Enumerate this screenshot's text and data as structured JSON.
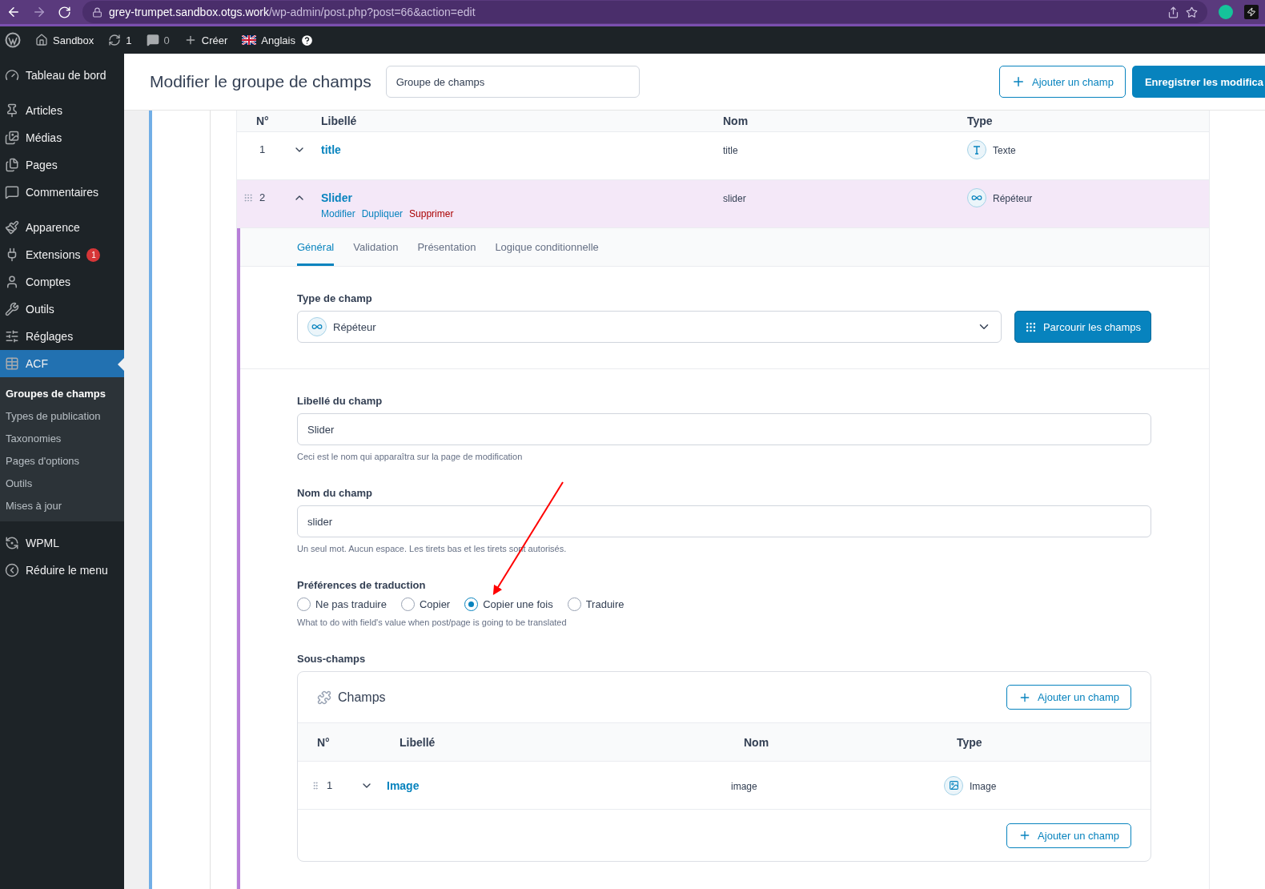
{
  "browser": {
    "url_host": "grey-trumpet.sandbox.otgs.work",
    "url_path": "/wp-admin/post.php?post=66&action=edit"
  },
  "admin_bar": {
    "site": "Sandbox",
    "updates": "1",
    "comments": "0",
    "new": "Créer",
    "language": "Anglais"
  },
  "sidebar": {
    "groups": [
      {
        "items": [
          {
            "label": "Tableau de bord",
            "selected": false
          }
        ]
      },
      {
        "items": [
          {
            "label": "Articles",
            "selected": false
          },
          {
            "label": "Médias",
            "selected": false
          },
          {
            "label": "Pages",
            "selected": false
          },
          {
            "label": "Commentaires",
            "selected": false
          }
        ]
      },
      {
        "items": [
          {
            "label": "Apparence",
            "selected": false
          },
          {
            "label": "Extensions",
            "selected": false,
            "badge": "1"
          },
          {
            "label": "Comptes",
            "selected": false
          },
          {
            "label": "Outils",
            "selected": false
          },
          {
            "label": "Réglages",
            "selected": false
          },
          {
            "label": "ACF",
            "selected": true,
            "children": [
              {
                "label": "Groupes de champs",
                "selected": true
              },
              {
                "label": "Types de publication",
                "selected": false
              },
              {
                "label": "Taxonomies",
                "selected": false
              },
              {
                "label": "Pages d'options",
                "selected": false
              },
              {
                "label": "Outils",
                "selected": false
              },
              {
                "label": "Mises à jour",
                "selected": false
              }
            ]
          }
        ]
      },
      {
        "items": [
          {
            "label": "WPML",
            "selected": false
          },
          {
            "label": "Réduire le menu",
            "selected": false
          }
        ]
      }
    ]
  },
  "header": {
    "title": "Modifier le groupe de champs",
    "group_name": "Groupe de champs",
    "add_button": "Ajouter un champ",
    "save_button": "Enregistrer les modifica"
  },
  "fields_table": {
    "columns": [
      "N°",
      "Libellé",
      "Nom",
      "Type"
    ],
    "rows": [
      {
        "number": "1",
        "label": "title",
        "name": "title",
        "type": "Texte",
        "kind": "text",
        "expanded": false
      },
      {
        "number": "2",
        "label": "Slider",
        "name": "slider",
        "type": "Répéteur",
        "kind": "repeater",
        "expanded": true,
        "actions": [
          {
            "label": "Modifier",
            "kind": "link"
          },
          {
            "label": "Dupliquer",
            "kind": "link"
          },
          {
            "label": "Supprimer",
            "kind": "danger"
          }
        ]
      }
    ]
  },
  "editor": {
    "tabs": [
      {
        "label": "Général",
        "selected": true
      },
      {
        "label": "Validation",
        "selected": false
      },
      {
        "label": "Présentation",
        "selected": false
      },
      {
        "label": "Logique conditionnelle",
        "selected": false
      }
    ],
    "field_type": {
      "label": "Type de champ",
      "value": "Répéteur",
      "kind": "repeater",
      "browse_button": "Parcourir les champs"
    },
    "field_label": {
      "label": "Libellé du champ",
      "value": "Slider",
      "hint": "Ceci est le nom qui apparaîtra sur la page de modification"
    },
    "field_name": {
      "label": "Nom du champ",
      "value": "slider",
      "hint": "Un seul mot. Aucun espace. Les tirets bas et les tirets sont autorisés."
    },
    "translation": {
      "label": "Préférences de traduction",
      "options": [
        {
          "label": "Ne pas traduire",
          "selected": false
        },
        {
          "label": "Copier",
          "selected": false
        },
        {
          "label": "Copier une fois",
          "selected": true
        },
        {
          "label": "Traduire",
          "selected": false
        }
      ],
      "hint": "What to do with field's value when post/page is going to be translated"
    },
    "subfields": {
      "label": "Sous-champs",
      "title": "Champs",
      "add_button": "Ajouter un champ",
      "columns": [
        "N°",
        "Libellé",
        "Nom",
        "Type"
      ],
      "rows": [
        {
          "number": "1",
          "label": "Image",
          "name": "image",
          "type": "Image",
          "kind": "image",
          "expanded": false
        }
      ],
      "footer_add_button": "Ajouter un champ"
    }
  }
}
